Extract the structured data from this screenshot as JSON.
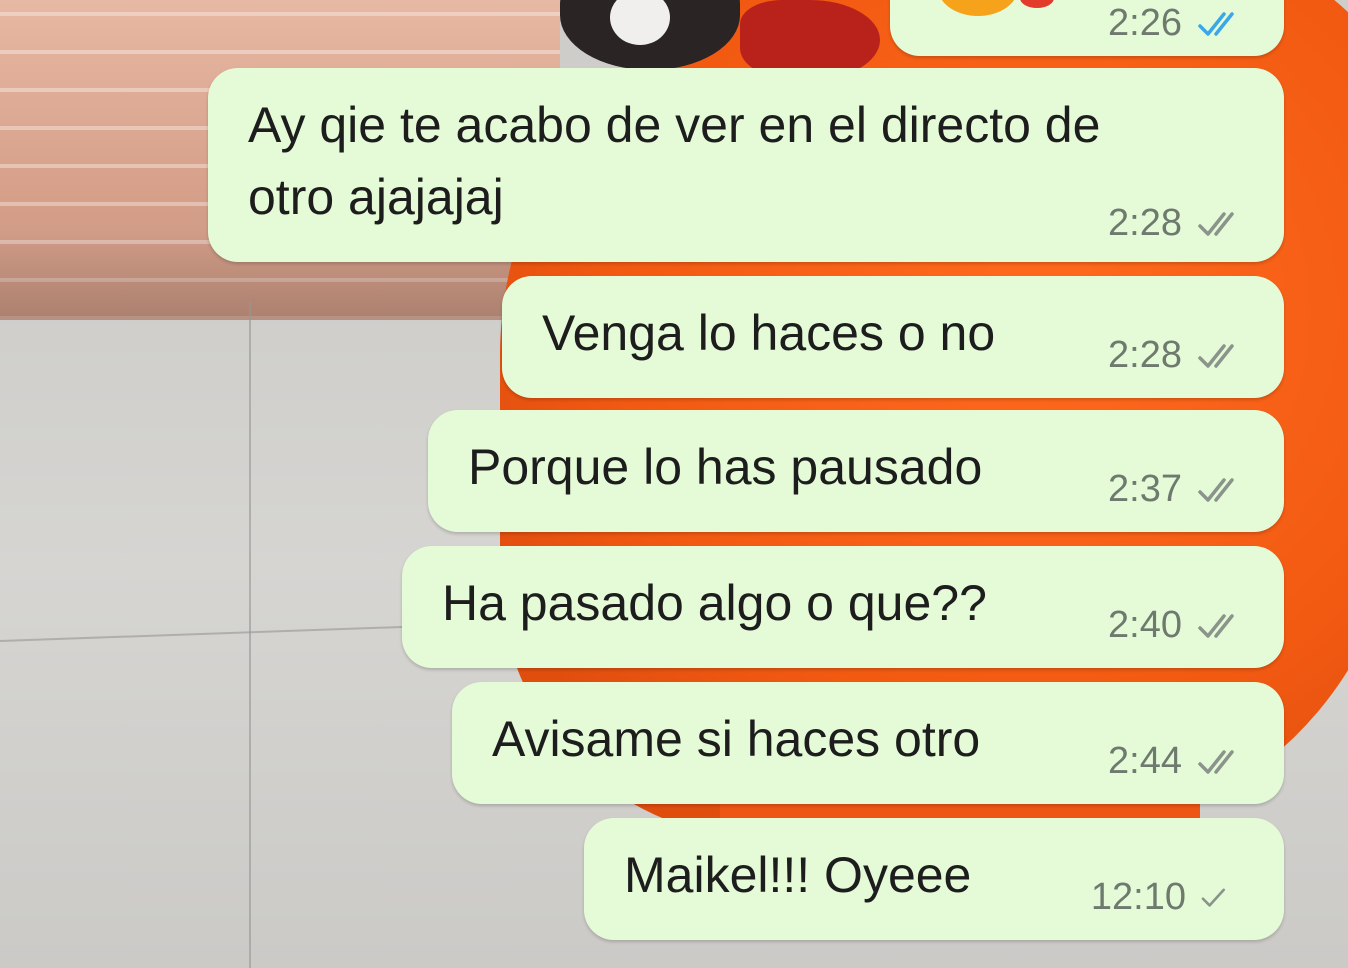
{
  "colors": {
    "bubble": "#e5fbd8",
    "text": "#1d1d1d",
    "time": "#6f7a6f",
    "tick_read": "#3aa7e8",
    "tick_delivered": "#8a948a"
  },
  "messages": [
    {
      "text_lines": [],
      "time": "2:26",
      "status": "read-ticks"
    },
    {
      "text_lines": [
        "Ay qie te acabo de ver en el directo de",
        "otro ajajajaj"
      ],
      "time": "2:28",
      "status": "double-tick"
    },
    {
      "text_lines": [
        "Venga lo haces o no"
      ],
      "time": "2:28",
      "status": "double-tick"
    },
    {
      "text_lines": [
        "Porque lo has pausado"
      ],
      "time": "2:37",
      "status": "double-tick"
    },
    {
      "text_lines": [
        "Ha pasado algo o que??"
      ],
      "time": "2:40",
      "status": "double-tick"
    },
    {
      "text_lines": [
        "Avisame si haces otro"
      ],
      "time": "2:44",
      "status": "double-tick"
    },
    {
      "text_lines": [
        "Maikel!!! Oyeee"
      ],
      "time": "12:10",
      "status": "single-tick"
    }
  ]
}
